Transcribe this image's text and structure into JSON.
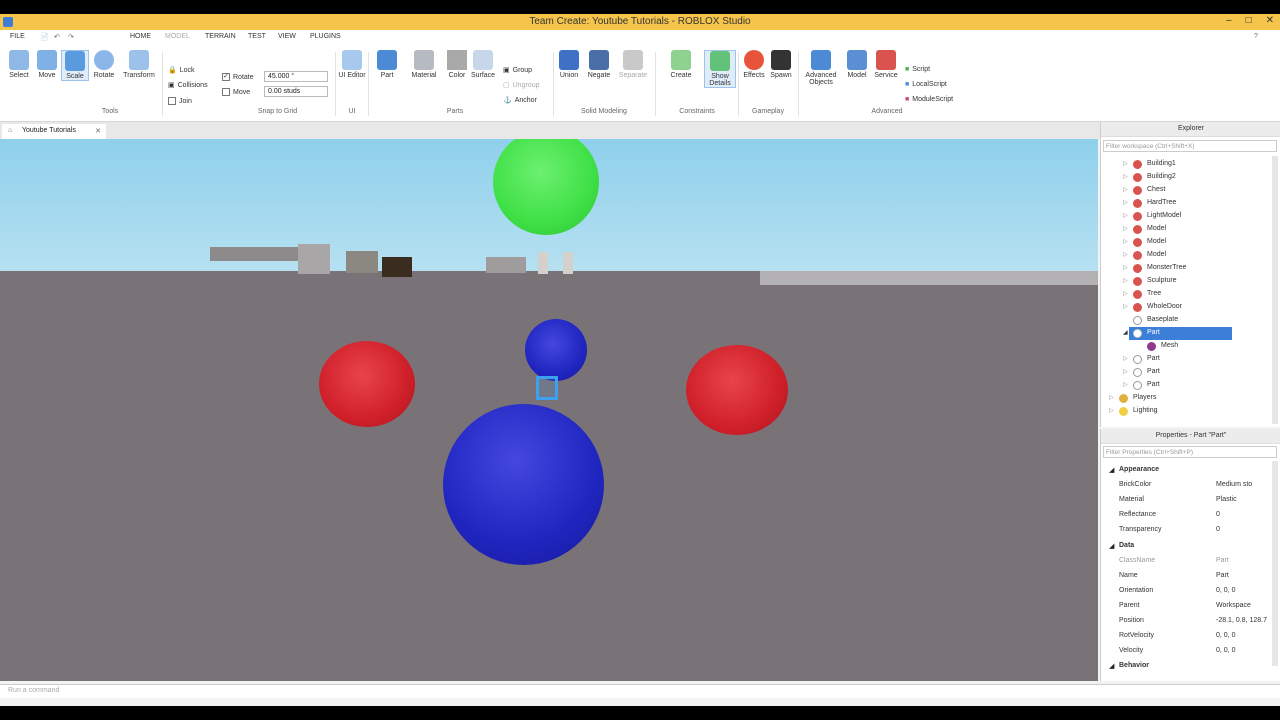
{
  "window": {
    "title": "Team Create: Youtube Tutorials - ROBLOX Studio"
  },
  "menu": [
    "FILE",
    "HOME",
    "MODEL",
    "TERRAIN",
    "TEST",
    "VIEW",
    "PLUGINS"
  ],
  "ribbon": {
    "tools": [
      "Select",
      "Move",
      "Scale",
      "Rotate",
      "Transform"
    ],
    "tools_group": "Tools",
    "lock": "Lock",
    "collisions": "Collisions",
    "join": "Join",
    "rotate_label": "Rotate",
    "rotate_value": "45.000 °",
    "move_label": "Move",
    "move_value": "0.00 studs",
    "snap_group": "Snap to Grid",
    "ui_editor": "UI Editor",
    "ui_group": "UI",
    "part": "Part",
    "material": "Material",
    "color": "Color",
    "surface": "Surface",
    "group": "Group",
    "ungroup": "Ungroup",
    "anchor": "Anchor",
    "parts_group": "Parts",
    "union": "Union",
    "negate": "Negate",
    "separate": "Separate",
    "solid_group": "Solid Modeling",
    "create": "Create",
    "show_details": "Show Details",
    "constraints_group": "Constraints",
    "effects": "Effects",
    "spawn": "Spawn",
    "gameplay_group": "Gameplay",
    "advanced_objects": "Advanced Objects",
    "model": "Model",
    "service": "Service",
    "script": "Script",
    "local_script": "LocalScript",
    "module_script": "ModuleScript",
    "advanced_group": "Advanced"
  },
  "doc_tab": "Youtube Tutorials",
  "explorer": {
    "title": "Explorer",
    "filter_placeholder": "Filter workspace (Ctrl+Shift+X)",
    "items": [
      "Building1",
      "Building2",
      "Chest",
      "HardTree",
      "LightModel",
      "Model",
      "Model",
      "Model",
      "MonsterTree",
      "Sculpture",
      "Tree",
      "WholeDoor",
      "Baseplate",
      "Part",
      "Mesh",
      "Part",
      "Part",
      "Part",
      "Players",
      "Lighting"
    ]
  },
  "properties": {
    "title": "Properties - Part \"Part\"",
    "filter_placeholder": "Filter Properties (Ctrl+Shift+P)",
    "rows": [
      {
        "name": "Appearance",
        "value": ""
      },
      {
        "name": "BrickColor",
        "value": "Medium sto"
      },
      {
        "name": "Material",
        "value": "Plastic"
      },
      {
        "name": "Reflectance",
        "value": "0"
      },
      {
        "name": "Transparency",
        "value": "0"
      },
      {
        "name": "Data",
        "value": ""
      },
      {
        "name": "ClassName",
        "value": "Part"
      },
      {
        "name": "Name",
        "value": "Part"
      },
      {
        "name": "Orientation",
        "value": "0, 0, 0"
      },
      {
        "name": "Parent",
        "value": "Workspace"
      },
      {
        "name": "Position",
        "value": "-28.1, 0.8, 128.7"
      },
      {
        "name": "RotVelocity",
        "value": "0, 0, 0"
      },
      {
        "name": "Velocity",
        "value": "0, 0, 0"
      },
      {
        "name": "Behavior",
        "value": ""
      }
    ]
  },
  "command_bar": {
    "placeholder": "Run a command"
  },
  "colors": {
    "title_bar": "#f5c44a",
    "selection": "#3c7fd9",
    "sphere_red": "#d0202a",
    "sphere_blue": "#2025c0",
    "sphere_green": "#3fe046"
  }
}
